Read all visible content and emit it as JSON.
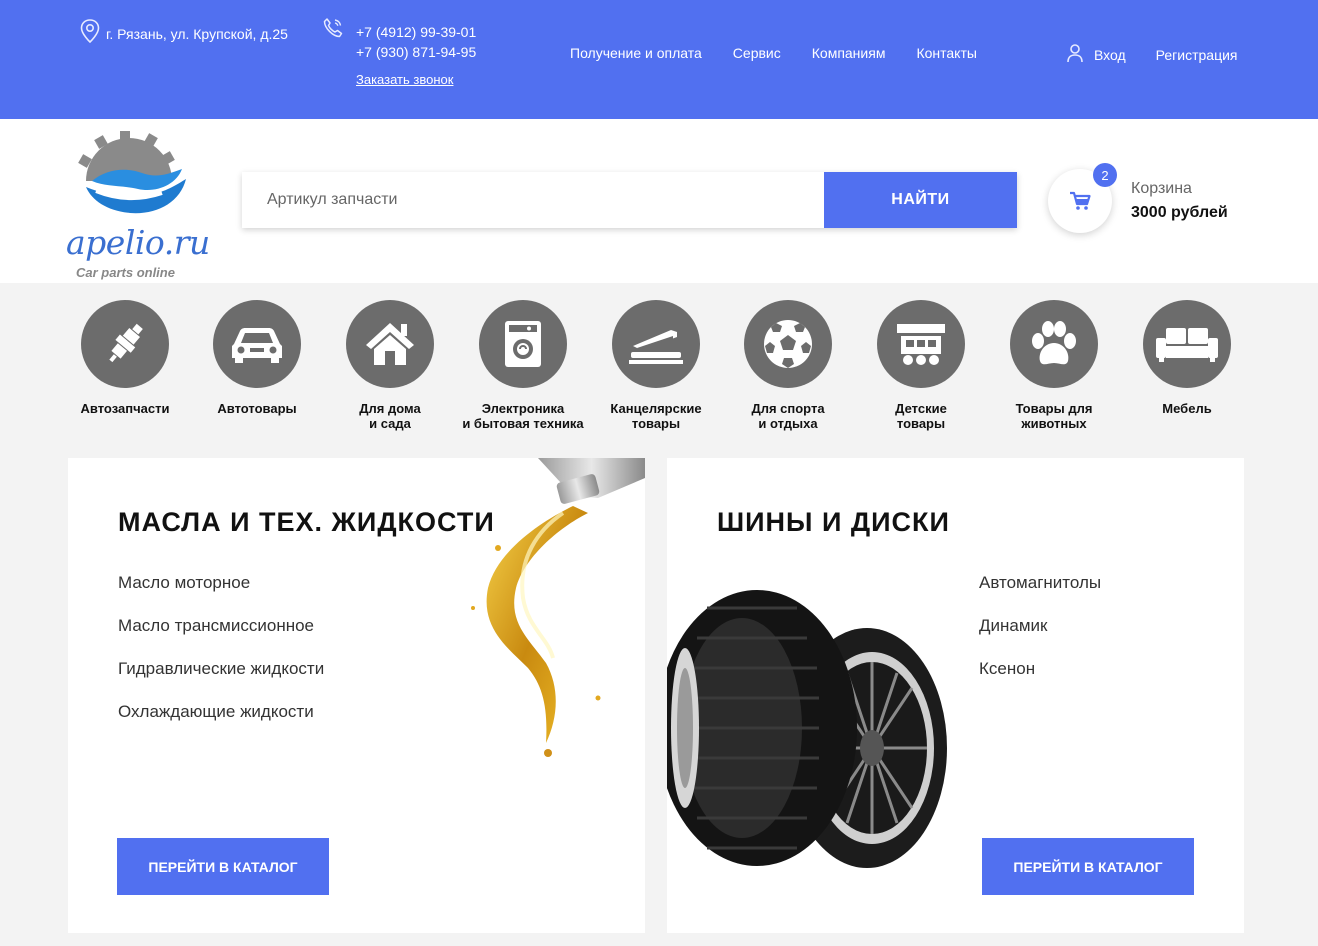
{
  "topbar": {
    "address": "г. Рязань, ул. Крупской, д.25",
    "phones": [
      "+7 (4912) 99-39-01",
      "+7 (930) 871-94-95"
    ],
    "callback": "Заказать звонок",
    "nav": [
      "Получение и оплата",
      "Сервис",
      "Компаниям",
      "Контакты"
    ],
    "login": "Вход",
    "register": "Регистрация"
  },
  "header": {
    "logo_text": "apelio.ru",
    "logo_tagline": "Car parts online",
    "search_placeholder": "Артикул запчасти",
    "search_button": "НАЙТИ",
    "cart_count": "2",
    "cart_label": "Корзина",
    "cart_total": "3000 рублей"
  },
  "categories": [
    {
      "line1": "Автозапчасти",
      "line2": "",
      "icon": "spark-plug-icon"
    },
    {
      "line1": "Автотовары",
      "line2": "",
      "icon": "car-icon"
    },
    {
      "line1": "Для дома",
      "line2": "и сада",
      "icon": "house-icon"
    },
    {
      "line1": "Электроника",
      "line2": "и бытовая техника",
      "icon": "washing-machine-icon"
    },
    {
      "line1": "Канцелярские",
      "line2": "товары",
      "icon": "stapler-icon"
    },
    {
      "line1": "Для спорта",
      "line2": "и отдыха",
      "icon": "soccer-ball-icon"
    },
    {
      "line1": "Детские",
      "line2": "товары",
      "icon": "toy-train-icon"
    },
    {
      "line1": "Товары для",
      "line2": "животных",
      "icon": "paw-icon"
    },
    {
      "line1": "Мебель",
      "line2": "",
      "icon": "sofa-icon"
    }
  ],
  "cards": [
    {
      "title": "МАСЛА И ТЕХ. ЖИДКОСТИ",
      "items": [
        "Масло моторное",
        "Масло трансмиссионное",
        "Гидравлические жидкости",
        "Охлаждающие жидкости"
      ],
      "button": "ПЕРЕЙТИ В КАТАЛОГ",
      "image": "oil-splash-icon"
    },
    {
      "title": "ШИНЫ И ДИСКИ",
      "items": [
        "Автомагнитолы",
        "Динамик",
        "Ксенон"
      ],
      "button": "ПЕРЕЙТИ В КАТАЛОГ",
      "image": "tires-icon"
    }
  ],
  "colors": {
    "accent": "#5170f0",
    "icon_gray": "#6c6c6c",
    "background": "#f3f3f3"
  }
}
